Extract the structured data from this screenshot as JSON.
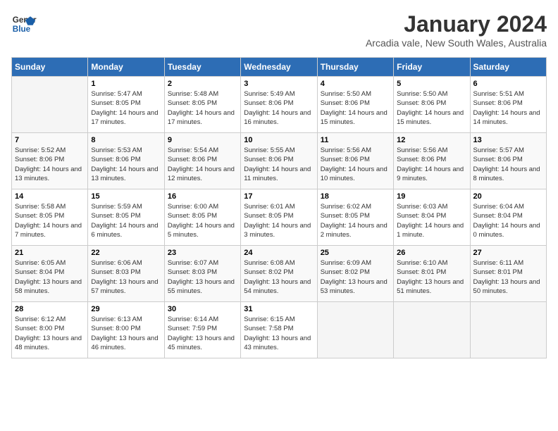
{
  "header": {
    "logo_line1": "General",
    "logo_line2": "Blue",
    "month": "January 2024",
    "location": "Arcadia vale, New South Wales, Australia"
  },
  "days_of_week": [
    "Sunday",
    "Monday",
    "Tuesday",
    "Wednesday",
    "Thursday",
    "Friday",
    "Saturday"
  ],
  "weeks": [
    [
      {
        "num": "",
        "empty": true
      },
      {
        "num": "1",
        "sunrise": "5:47 AM",
        "sunset": "8:05 PM",
        "daylight": "14 hours and 17 minutes."
      },
      {
        "num": "2",
        "sunrise": "5:48 AM",
        "sunset": "8:05 PM",
        "daylight": "14 hours and 17 minutes."
      },
      {
        "num": "3",
        "sunrise": "5:49 AM",
        "sunset": "8:06 PM",
        "daylight": "14 hours and 16 minutes."
      },
      {
        "num": "4",
        "sunrise": "5:50 AM",
        "sunset": "8:06 PM",
        "daylight": "14 hours and 15 minutes."
      },
      {
        "num": "5",
        "sunrise": "5:50 AM",
        "sunset": "8:06 PM",
        "daylight": "14 hours and 15 minutes."
      },
      {
        "num": "6",
        "sunrise": "5:51 AM",
        "sunset": "8:06 PM",
        "daylight": "14 hours and 14 minutes."
      }
    ],
    [
      {
        "num": "7",
        "sunrise": "5:52 AM",
        "sunset": "8:06 PM",
        "daylight": "14 hours and 13 minutes."
      },
      {
        "num": "8",
        "sunrise": "5:53 AM",
        "sunset": "8:06 PM",
        "daylight": "14 hours and 13 minutes."
      },
      {
        "num": "9",
        "sunrise": "5:54 AM",
        "sunset": "8:06 PM",
        "daylight": "14 hours and 12 minutes."
      },
      {
        "num": "10",
        "sunrise": "5:55 AM",
        "sunset": "8:06 PM",
        "daylight": "14 hours and 11 minutes."
      },
      {
        "num": "11",
        "sunrise": "5:56 AM",
        "sunset": "8:06 PM",
        "daylight": "14 hours and 10 minutes."
      },
      {
        "num": "12",
        "sunrise": "5:56 AM",
        "sunset": "8:06 PM",
        "daylight": "14 hours and 9 minutes."
      },
      {
        "num": "13",
        "sunrise": "5:57 AM",
        "sunset": "8:06 PM",
        "daylight": "14 hours and 8 minutes."
      }
    ],
    [
      {
        "num": "14",
        "sunrise": "5:58 AM",
        "sunset": "8:05 PM",
        "daylight": "14 hours and 7 minutes."
      },
      {
        "num": "15",
        "sunrise": "5:59 AM",
        "sunset": "8:05 PM",
        "daylight": "14 hours and 6 minutes."
      },
      {
        "num": "16",
        "sunrise": "6:00 AM",
        "sunset": "8:05 PM",
        "daylight": "14 hours and 5 minutes."
      },
      {
        "num": "17",
        "sunrise": "6:01 AM",
        "sunset": "8:05 PM",
        "daylight": "14 hours and 3 minutes."
      },
      {
        "num": "18",
        "sunrise": "6:02 AM",
        "sunset": "8:05 PM",
        "daylight": "14 hours and 2 minutes."
      },
      {
        "num": "19",
        "sunrise": "6:03 AM",
        "sunset": "8:04 PM",
        "daylight": "14 hours and 1 minute."
      },
      {
        "num": "20",
        "sunrise": "6:04 AM",
        "sunset": "8:04 PM",
        "daylight": "14 hours and 0 minutes."
      }
    ],
    [
      {
        "num": "21",
        "sunrise": "6:05 AM",
        "sunset": "8:04 PM",
        "daylight": "13 hours and 58 minutes."
      },
      {
        "num": "22",
        "sunrise": "6:06 AM",
        "sunset": "8:03 PM",
        "daylight": "13 hours and 57 minutes."
      },
      {
        "num": "23",
        "sunrise": "6:07 AM",
        "sunset": "8:03 PM",
        "daylight": "13 hours and 55 minutes."
      },
      {
        "num": "24",
        "sunrise": "6:08 AM",
        "sunset": "8:02 PM",
        "daylight": "13 hours and 54 minutes."
      },
      {
        "num": "25",
        "sunrise": "6:09 AM",
        "sunset": "8:02 PM",
        "daylight": "13 hours and 53 minutes."
      },
      {
        "num": "26",
        "sunrise": "6:10 AM",
        "sunset": "8:01 PM",
        "daylight": "13 hours and 51 minutes."
      },
      {
        "num": "27",
        "sunrise": "6:11 AM",
        "sunset": "8:01 PM",
        "daylight": "13 hours and 50 minutes."
      }
    ],
    [
      {
        "num": "28",
        "sunrise": "6:12 AM",
        "sunset": "8:00 PM",
        "daylight": "13 hours and 48 minutes."
      },
      {
        "num": "29",
        "sunrise": "6:13 AM",
        "sunset": "8:00 PM",
        "daylight": "13 hours and 46 minutes."
      },
      {
        "num": "30",
        "sunrise": "6:14 AM",
        "sunset": "7:59 PM",
        "daylight": "13 hours and 45 minutes."
      },
      {
        "num": "31",
        "sunrise": "6:15 AM",
        "sunset": "7:58 PM",
        "daylight": "13 hours and 43 minutes."
      },
      {
        "num": "",
        "empty": true
      },
      {
        "num": "",
        "empty": true
      },
      {
        "num": "",
        "empty": true
      }
    ]
  ],
  "labels": {
    "sunrise_prefix": "Sunrise: ",
    "sunset_prefix": "Sunset: ",
    "daylight_prefix": "Daylight: "
  }
}
